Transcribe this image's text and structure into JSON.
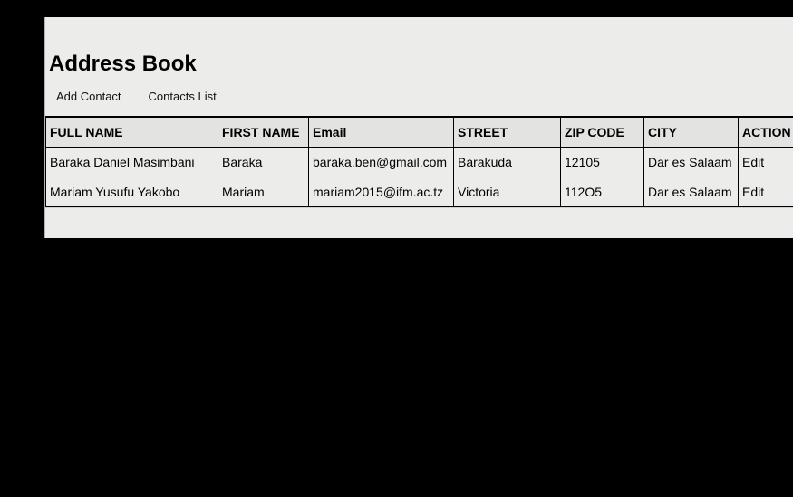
{
  "header": {
    "title": "Address Book"
  },
  "nav": {
    "add_contact": "Add Contact",
    "contacts_list": "Contacts List"
  },
  "table": {
    "headers": {
      "full_name": "FULL NAME",
      "first_name": "FIRST NAME",
      "email": "Email",
      "street": "STREET",
      "zip": "ZIP CODE",
      "city": "CITY",
      "action": "ACTION"
    },
    "rows": [
      {
        "full_name": "Baraka Daniel Masimbani",
        "first_name": "Baraka",
        "email": "baraka.ben@gmail.com",
        "street": "Barakuda",
        "zip": "12105",
        "city": "Dar es Salaam",
        "action": "Edit"
      },
      {
        "full_name": "Mariam Yusufu Yakobo",
        "first_name": "Mariam",
        "email": "mariam2015@ifm.ac.tz",
        "street": "Victoria",
        "zip": "112O5",
        "city": "Dar es Salaam",
        "action": "Edit"
      }
    ]
  }
}
